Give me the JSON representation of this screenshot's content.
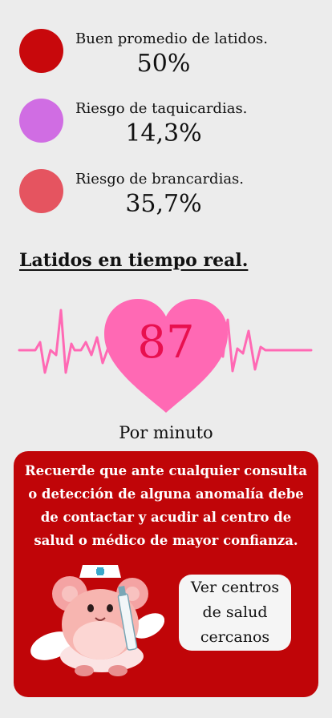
{
  "colors": {
    "background": "#ececec",
    "stat_good": "#c8080c",
    "stat_tachy": "#d06de3",
    "stat_brady": "#e55460",
    "heart": "#ff69b4",
    "heart_rate_text": "#e8104f",
    "pulse_line": "#ff69b4",
    "card": "#c00508",
    "button": "#f5f5f5"
  },
  "stats": [
    {
      "label": "Buen promedio de latidos.",
      "value": "50%",
      "color": "#c8080c"
    },
    {
      "label": "Riesgo de taquicardias.",
      "value": "14,3%",
      "color": "#d06de3"
    },
    {
      "label": "Riesgo de brancardias.",
      "value": "35,7%",
      "color": "#e55460"
    }
  ],
  "realtime": {
    "title": "Latidos en tiempo real.",
    "bpm": "87",
    "unit": "Por minuto",
    "icon": "heart-icon"
  },
  "notice": {
    "text": "Recuerde que ante cualquier consulta o detección de alguna anomalía debe de contactar y acudir al centro de salud o médico de mayor confianza.",
    "button_label": "Ver centros de salud cercanos",
    "illustration": "nurse-mascot-illustration"
  }
}
